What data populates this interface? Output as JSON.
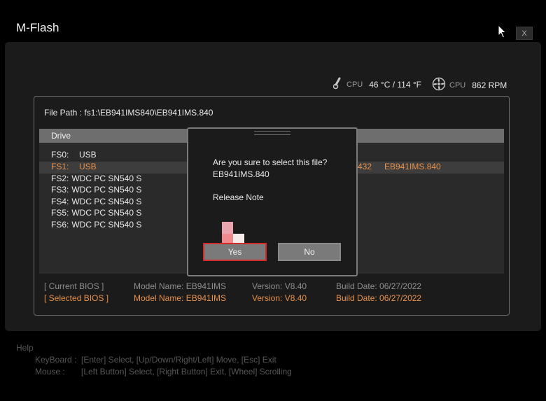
{
  "app": {
    "title": "M-Flash",
    "close_label": "X"
  },
  "sensors": {
    "cpu_temp": {
      "icon": "thermometer-icon",
      "label": "CPU",
      "value": "46 °C / 114 °F"
    },
    "cpu_fan": {
      "icon": "fan-icon",
      "label": "CPU",
      "value": "862 RPM"
    }
  },
  "file_path": "File Path :  fs1:\\EB941IMS840\\EB941IMS.840",
  "drive_header": "Drive",
  "drives": [
    {
      "id": "FS0:",
      "name": "USB"
    },
    {
      "id": "FS1:",
      "name": "USB",
      "selected": true
    },
    {
      "id": "FS2:",
      "name": "WDC PC SN540 S"
    },
    {
      "id": "FS3:",
      "name": "WDC PC SN540 S"
    },
    {
      "id": "FS4:",
      "name": "WDC PC SN540 S"
    },
    {
      "id": "FS5:",
      "name": "WDC PC SN540 S"
    },
    {
      "id": "FS6:",
      "name": "WDC PC SN540 S"
    }
  ],
  "selected_file_row": {
    "size_fragment": "432",
    "filename": "EB941IMS.840"
  },
  "bios_info": {
    "current": {
      "label": "[ Current BIOS  ]",
      "model": "Model Name: EB941IMS",
      "version": "Version: V8.40",
      "build_date": "Build Date: 06/27/2022"
    },
    "selected": {
      "label": "[ Selected BIOS ]",
      "model": "Model Name: EB941IMS",
      "version": "Version: V8.40",
      "build_date": "Build Date: 06/27/2022"
    }
  },
  "dialog": {
    "question": "Are you sure to select this file?",
    "filename": "EB941IMS.840",
    "release_note": "Release Note",
    "yes_label": "Yes",
    "no_label": "No"
  },
  "help": {
    "title": "Help",
    "keyboard_prefix": "KeyBoard :",
    "keyboard_text": "[Enter]  Select,   [Up/Down/Right/Left]  Move,    [Esc]  Exit",
    "mouse_prefix": "Mouse     :",
    "mouse_text": "[Left Button]  Select,   [Right Button]  Exit,   [Wheel]  Scrolling"
  },
  "colors": {
    "accent_orange": "#e8914a",
    "selection_red": "#d12a2a",
    "panel_border": "#6e6e6e"
  }
}
